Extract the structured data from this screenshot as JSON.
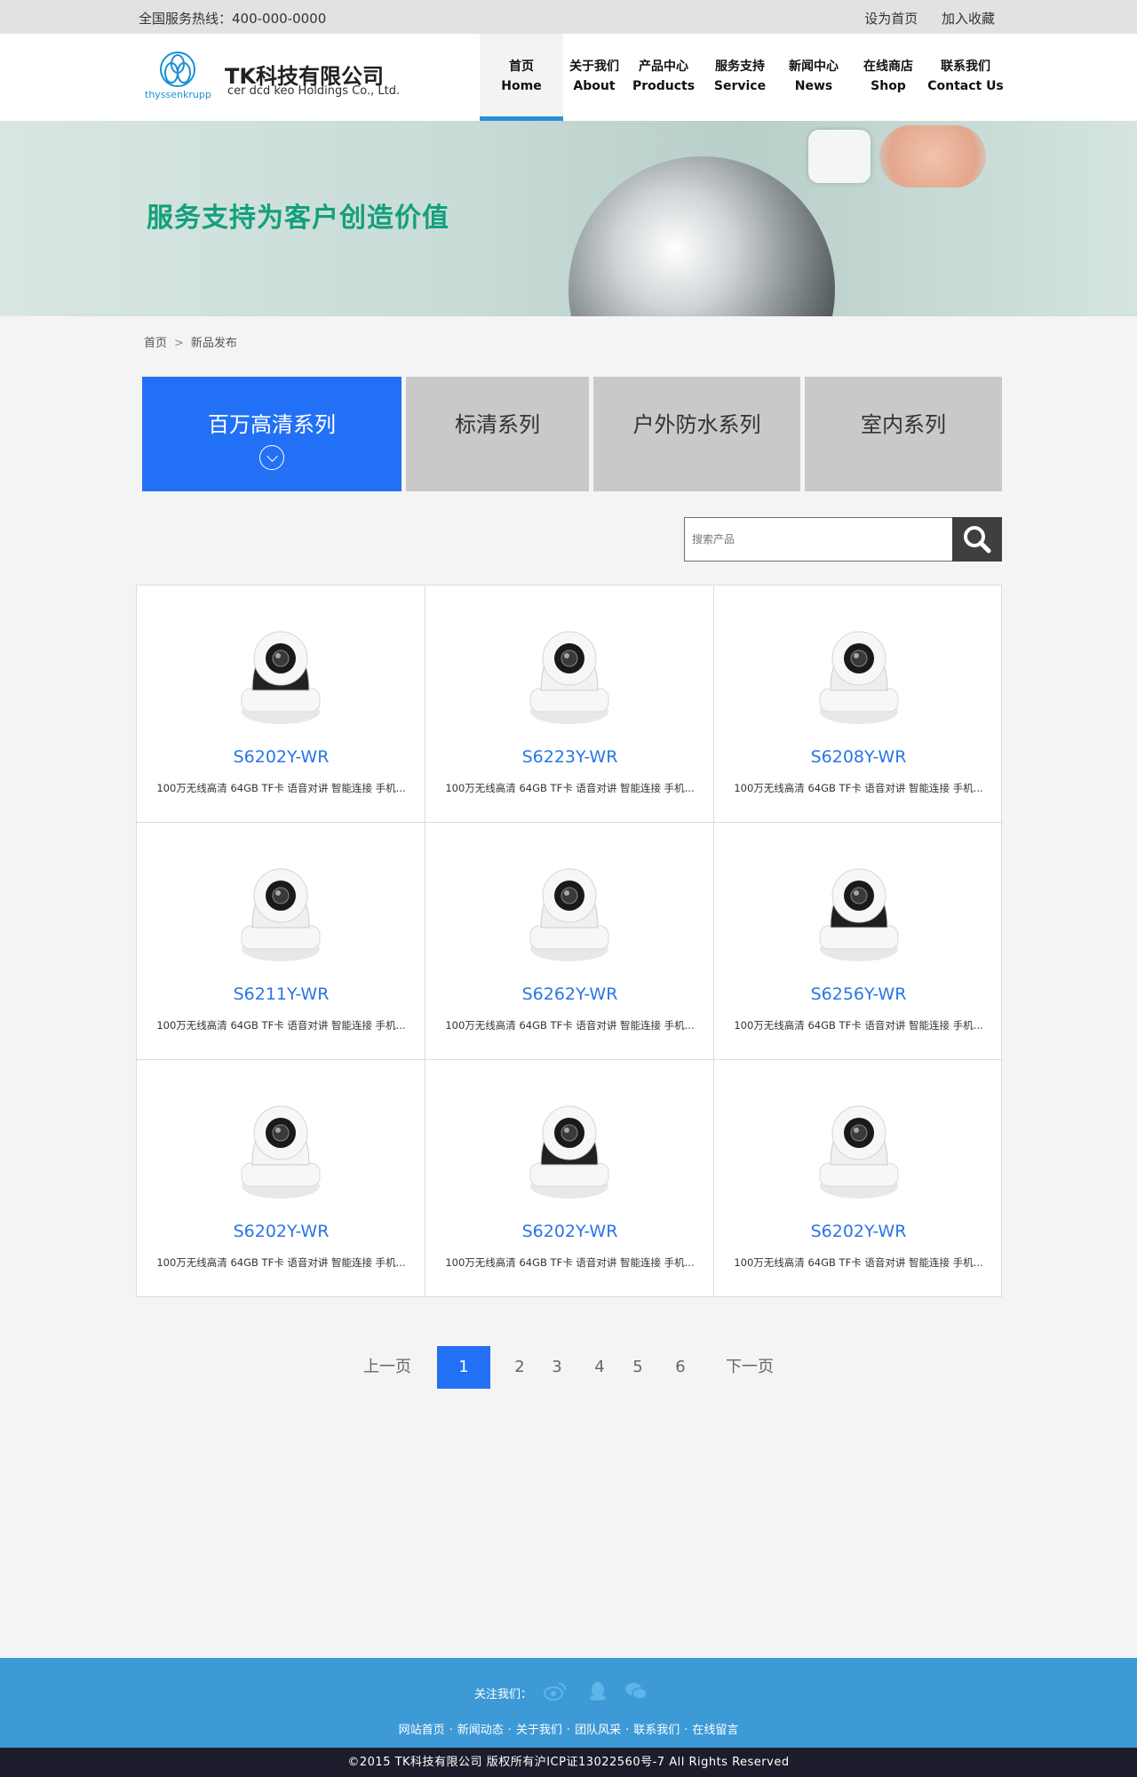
{
  "topbar": {
    "hotline": "全国服务热线：400-000-0000",
    "set_home": "设为首页",
    "add_favorite": "加入收藏"
  },
  "brand": {
    "logo_text": "thyssenkrupp",
    "title": "TK科技有限公司",
    "subtitle": "cer dcd keo Holdings Co., Ltd."
  },
  "nav": [
    {
      "cn": "首页",
      "en": "Home"
    },
    {
      "cn": "关于我们",
      "en": "About"
    },
    {
      "cn": "产品中心",
      "en": "Products"
    },
    {
      "cn": "服务支持",
      "en": "Service"
    },
    {
      "cn": "新闻中心",
      "en": "News"
    },
    {
      "cn": "在线商店",
      "en": "Shop"
    },
    {
      "cn": "联系我们",
      "en": "Contact Us"
    }
  ],
  "banner": {
    "slogan": "服务支持为客户创造价值"
  },
  "breadcrumb": {
    "home": "首页",
    "current": "新品发布"
  },
  "tabs": [
    {
      "label": "百万高清系列"
    },
    {
      "label": "标清系列"
    },
    {
      "label": "户外防水系列"
    },
    {
      "label": "室内系列"
    }
  ],
  "search": {
    "placeholder": "搜索产品"
  },
  "products": [
    {
      "model": "S6202Y-WR",
      "desc": "100万无线高清 64GB TF卡 语音对讲 智能连接 手机..."
    },
    {
      "model": "S6223Y-WR",
      "desc": "100万无线高清 64GB TF卡 语音对讲 智能连接 手机..."
    },
    {
      "model": "S6208Y-WR",
      "desc": "100万无线高清 64GB TF卡 语音对讲 智能连接 手机..."
    },
    {
      "model": "S6211Y-WR",
      "desc": "100万无线高清 64GB TF卡 语音对讲 智能连接 手机..."
    },
    {
      "model": "S6262Y-WR",
      "desc": "100万无线高清 64GB TF卡 语音对讲 智能连接 手机..."
    },
    {
      "model": "S6256Y-WR",
      "desc": "100万无线高清 64GB TF卡 语音对讲 智能连接 手机..."
    },
    {
      "model": "S6202Y-WR",
      "desc": "100万无线高清 64GB TF卡 语音对讲 智能连接 手机..."
    },
    {
      "model": "S6202Y-WR",
      "desc": "100万无线高清 64GB TF卡 语音对讲 智能连接 手机..."
    },
    {
      "model": "S6202Y-WR",
      "desc": "100万无线高清 64GB TF卡 语音对讲 智能连接 手机..."
    }
  ],
  "pagination": {
    "prev": "上一页",
    "pages": [
      "1",
      "2",
      "3",
      "4",
      "5",
      "6"
    ],
    "next": "下一页"
  },
  "footer": {
    "follow": "关注我们：",
    "social_icons": [
      "weibo-icon",
      "qq-icon",
      "wechat-icon"
    ],
    "links": [
      "网站首页",
      "新闻动态",
      "关于我们",
      "团队风采",
      "联系我们",
      "在线留言"
    ],
    "copyright": "©2015 TK科技有限公司  版权所有沪ICP证13022560号-7 All Rights Reserved"
  },
  "colors": {
    "accent": "#2270f5",
    "nav_underline": "#2a8fd6",
    "slogan": "#13a07c",
    "footer_bg": "#3e9ad6",
    "copyright_bg": "#1c1c2c",
    "model_text": "#2a75e6"
  }
}
